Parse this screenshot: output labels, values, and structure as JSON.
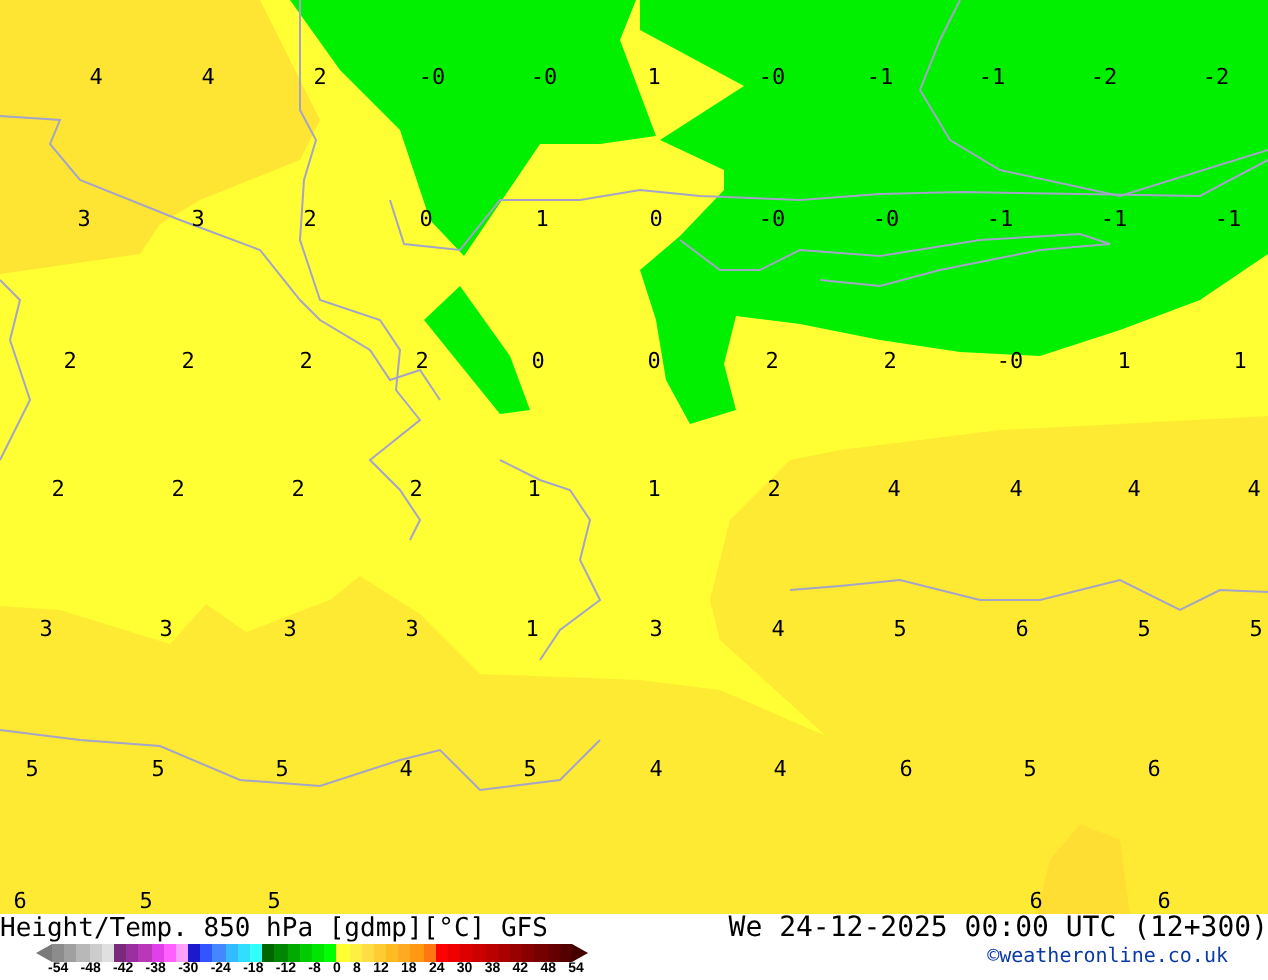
{
  "map": {
    "label_rows": [
      [
        "4",
        "4",
        "2",
        "-0",
        "-0",
        "1",
        "-0",
        "-1",
        "-1",
        "-2",
        "-2"
      ],
      [
        "3",
        "3",
        "2",
        "0",
        "1",
        "0",
        "-0",
        "-0",
        "-1",
        "-1",
        "-1"
      ],
      [
        "2",
        "2",
        "2",
        "2",
        "0",
        "0",
        "2",
        "2",
        "-0",
        "1",
        "1"
      ],
      [
        "2",
        "2",
        "2",
        "2",
        "1",
        "1",
        "2",
        "4",
        "4",
        "4",
        "4"
      ],
      [
        "3",
        "3",
        "3",
        "3",
        "1",
        "3",
        "4",
        "5",
        "6",
        "5",
        "5"
      ],
      [
        "5",
        "5",
        "5",
        "4",
        "5",
        "4",
        "4",
        "6",
        "5",
        "6"
      ],
      [
        "6",
        "5",
        "5",
        "6",
        "6"
      ]
    ]
  },
  "footer": {
    "title": "Height/Temp. 850 hPa [gdmp][°C] GFS",
    "valid_time": "We 24-12-2025 00:00 UTC (12+300)",
    "copyright": "©weatheronline.co.uk",
    "colorbar": {
      "swatches": [
        {
          "kind": "arrow-left",
          "color": "#7a7a7a"
        },
        {
          "kind": "box",
          "color": "#8c8c8c"
        },
        {
          "kind": "box",
          "color": "#a0a0a0"
        },
        {
          "kind": "box",
          "color": "#b8b8b8"
        },
        {
          "kind": "box",
          "color": "#cccccc"
        },
        {
          "kind": "box",
          "color": "#e0e0e0"
        },
        {
          "kind": "box",
          "color": "#7a2a7a"
        },
        {
          "kind": "box",
          "color": "#9a30a0"
        },
        {
          "kind": "box",
          "color": "#b838b8"
        },
        {
          "kind": "box",
          "color": "#e040e8"
        },
        {
          "kind": "box",
          "color": "#ff60ff"
        },
        {
          "kind": "box",
          "color": "#ffa0ff"
        },
        {
          "kind": "box",
          "color": "#1a1acc"
        },
        {
          "kind": "box",
          "color": "#3355ff"
        },
        {
          "kind": "box",
          "color": "#4488ff"
        },
        {
          "kind": "box",
          "color": "#33bbff"
        },
        {
          "kind": "box",
          "color": "#33ddff"
        },
        {
          "kind": "box",
          "color": "#33ffff"
        },
        {
          "kind": "box",
          "color": "#006600"
        },
        {
          "kind": "box",
          "color": "#008800"
        },
        {
          "kind": "box",
          "color": "#00aa00"
        },
        {
          "kind": "box",
          "color": "#00cc00"
        },
        {
          "kind": "box",
          "color": "#00e600"
        },
        {
          "kind": "box",
          "color": "#00ff00"
        },
        {
          "kind": "box",
          "color": "#ffff33"
        },
        {
          "kind": "box",
          "color": "#ffee44"
        },
        {
          "kind": "box",
          "color": "#ffdd44"
        },
        {
          "kind": "box",
          "color": "#ffcc33"
        },
        {
          "kind": "box",
          "color": "#ffbb22"
        },
        {
          "kind": "box",
          "color": "#ffaa22"
        },
        {
          "kind": "box",
          "color": "#ff9911"
        },
        {
          "kind": "box",
          "color": "#ff7711"
        },
        {
          "kind": "box",
          "color": "#ff0000"
        },
        {
          "kind": "box",
          "color": "#ee0000"
        },
        {
          "kind": "box",
          "color": "#dd0000"
        },
        {
          "kind": "box",
          "color": "#cc0000"
        },
        {
          "kind": "box",
          "color": "#bb0000"
        },
        {
          "kind": "box",
          "color": "#aa0000"
        },
        {
          "kind": "box",
          "color": "#990000"
        },
        {
          "kind": "box",
          "color": "#880000"
        },
        {
          "kind": "box",
          "color": "#770000"
        },
        {
          "kind": "box",
          "color": "#660000"
        },
        {
          "kind": "box",
          "color": "#550000"
        },
        {
          "kind": "arrow-right",
          "color": "#440000"
        }
      ],
      "ticks": [
        "-54",
        "-48",
        "-42",
        "-38",
        "-30",
        "-24",
        "-18",
        "-12",
        "-8",
        "0",
        "8",
        "12",
        "18",
        "24",
        "30",
        "38",
        "42",
        "48",
        "54"
      ]
    }
  }
}
